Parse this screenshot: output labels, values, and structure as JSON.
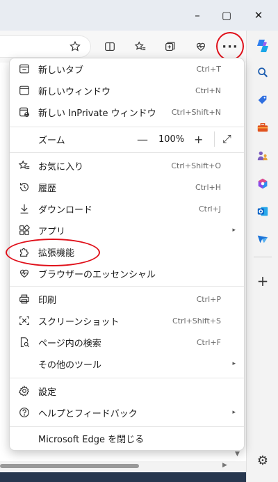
{
  "window": {
    "minimize_glyph": "–",
    "maximize_glyph": "▢",
    "close_glyph": "✕"
  },
  "toolbar": {
    "icons": [
      "star-outline-icon",
      "split-screen-icon",
      "favorites-icon",
      "collections-icon",
      "browser-essentials-icon"
    ],
    "more_glyph": "···"
  },
  "menu": {
    "new_tab": {
      "label": "新しいタブ",
      "shortcut": "Ctrl+T",
      "icon": "new-tab-icon"
    },
    "new_window": {
      "label": "新しいウィンドウ",
      "shortcut": "Ctrl+N",
      "icon": "new-window-icon"
    },
    "new_inprivate": {
      "label": "新しい InPrivate ウィンドウ",
      "shortcut": "Ctrl+Shift+N",
      "icon": "inprivate-icon"
    },
    "zoom": {
      "label": "ズーム",
      "minus": "—",
      "value": "100%",
      "plus": "+",
      "fullscreen": "⤢"
    },
    "favorites": {
      "label": "お気に入り",
      "shortcut": "Ctrl+Shift+O",
      "icon": "favorites-icon"
    },
    "history": {
      "label": "履歴",
      "shortcut": "Ctrl+H",
      "icon": "history-icon"
    },
    "downloads": {
      "label": "ダウンロード",
      "shortcut": "Ctrl+J",
      "icon": "download-icon"
    },
    "apps": {
      "label": "アプリ",
      "arrow": "▸",
      "icon": "apps-icon"
    },
    "extensions": {
      "label": "拡張機能",
      "icon": "puzzle-icon"
    },
    "essentials": {
      "label": "ブラウザーのエッセンシャル",
      "icon": "heart-pulse-icon"
    },
    "print": {
      "label": "印刷",
      "shortcut": "Ctrl+P",
      "icon": "print-icon"
    },
    "screenshot": {
      "label": "スクリーンショット",
      "shortcut": "Ctrl+Shift+S",
      "icon": "screenshot-icon"
    },
    "find": {
      "label": "ページ内の検索",
      "shortcut": "Ctrl+F",
      "icon": "find-icon"
    },
    "more_tools": {
      "label": "その他のツール",
      "arrow": "▸"
    },
    "settings": {
      "label": "設定",
      "icon": "settings-icon"
    },
    "help": {
      "label": "ヘルプとフィードバック",
      "arrow": "▸",
      "icon": "help-icon"
    },
    "close_edge": {
      "label": "Microsoft Edge を閉じる"
    }
  },
  "sidebar": {
    "icons": [
      "copilot-icon",
      "search-icon",
      "shopping-tag-icon",
      "toolbox-icon",
      "games-icon",
      "microsoft365-icon",
      "outlook-icon",
      "send-icon",
      "add-icon",
      "settings-icon"
    ],
    "add_glyph": "+",
    "gear_glyph": "⚙"
  },
  "annotations": {
    "highlight_color": "#e0101a"
  }
}
